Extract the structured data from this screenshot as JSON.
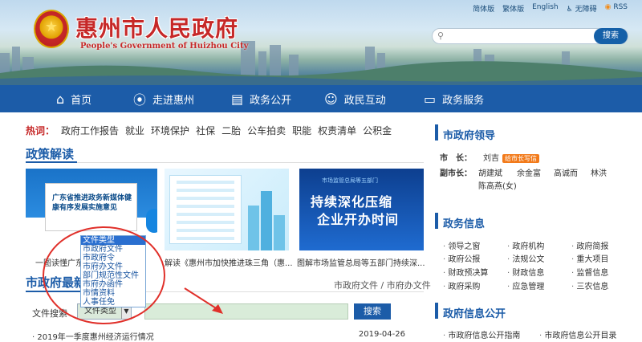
{
  "header": {
    "title": "惠州市人民政府",
    "subtitle": "People's Government of Huizhou City",
    "top_links": [
      "简体版",
      "繁体版",
      "English",
      "无障碍",
      "RSS"
    ],
    "search_button": "搜索",
    "accent": "#1c5ca8"
  },
  "nav": [
    {
      "label": "首页",
      "icon": "home-icon"
    },
    {
      "label": "走进惠州",
      "icon": "location-pin-icon"
    },
    {
      "label": "政务公开",
      "icon": "document-icon"
    },
    {
      "label": "政民互动",
      "icon": "people-icon"
    },
    {
      "label": "政务服务",
      "icon": "monitor-icon"
    }
  ],
  "hot": {
    "label": "热词：",
    "items": [
      "政府工作报告",
      "就业",
      "环境保护",
      "社保",
      "二胎",
      "公车拍卖",
      "职能",
      "权责清单",
      "公积金"
    ]
  },
  "policy": {
    "title": "政策解读",
    "image1_text": "广东省推进政务新媒体健康有序发展实施意见",
    "image3_text": [
      "市场监管总局等五部门",
      "持续深化压缩",
      "企业开办时间"
    ],
    "captions": [
      "一图读懂广东",
      "解读《惠州市加快推进珠三角（惠...",
      "图解市场监管总局等五部门持续深..."
    ]
  },
  "files": {
    "title": "市政府最新",
    "links": "市政府文件 / 市府办文件",
    "search_label": "文件搜索",
    "select_value": "文件类型",
    "search_button": "搜索",
    "dropdown_options": [
      "文件类型",
      "市政府文件",
      "市政府令",
      "市府办文件",
      "部门规范性文件",
      "市府办函件",
      "市情资料",
      "人事任免"
    ],
    "news": [
      {
        "title": "2019年一季度惠州经济运行情况",
        "date": "2019-04-26"
      }
    ]
  },
  "leaders": {
    "title": "市政府领导",
    "mayor_label": "市　长：",
    "mayor": "刘吉",
    "mayor_tag": "给市长写信",
    "vice_label": "副市长：",
    "vice": [
      "胡建斌",
      "余金富",
      "高诚而",
      "林洪",
      "陈高燕(女)"
    ]
  },
  "gov_info": {
    "title": "政务信息",
    "items": [
      "领导之窗",
      "政府机构",
      "政府简报",
      "政府公报",
      "法规公文",
      "重大项目",
      "财政预决算",
      "财政信息",
      "监督信息",
      "政府采购",
      "应急管理",
      "三农信息"
    ]
  },
  "public_info": {
    "title": "政府信息公开",
    "items": [
      "市政府信息公开指南",
      "市政府信息公开目录"
    ]
  }
}
